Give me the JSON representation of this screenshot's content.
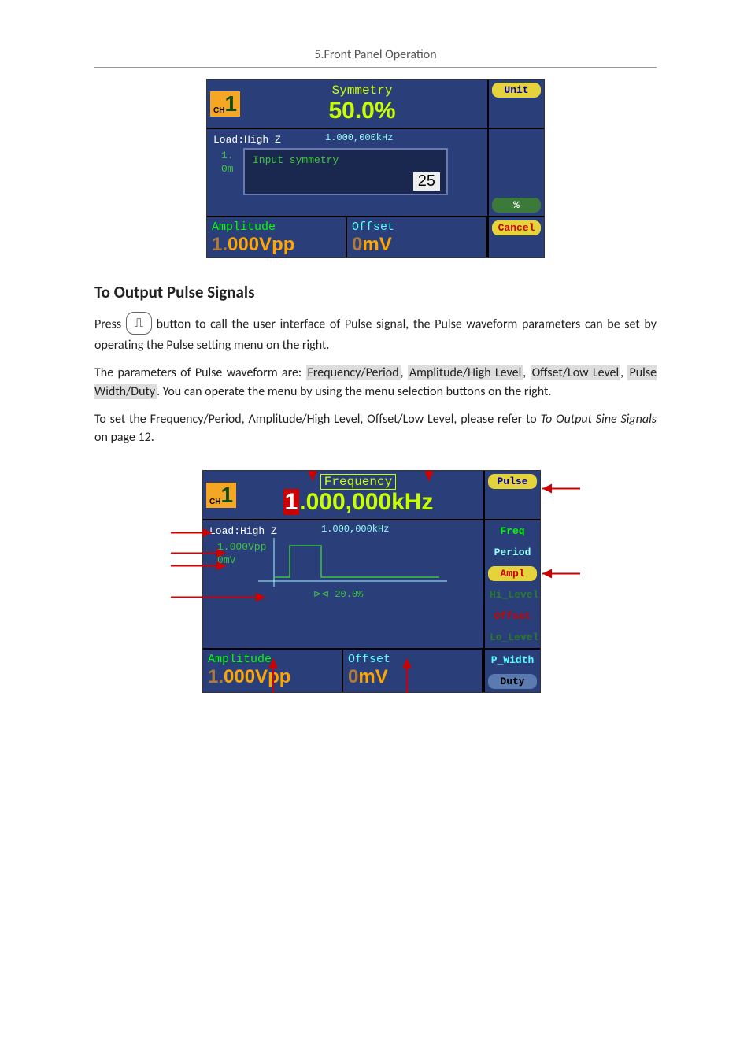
{
  "header": "5.Front Panel Operation",
  "inst1": {
    "ch_small": "CH",
    "ch_big": "1",
    "top_label": "Symmetry",
    "top_value": "50.0%",
    "load": "Load:High Z",
    "freq_span": "1.000,000kHz",
    "popup_label": "Input symmetry",
    "popup_value": "25",
    "wave_v1": "1.",
    "wave_v2": "0m",
    "side": {
      "unit": "Unit",
      "pct": "%",
      "cancel": "Cancel"
    },
    "ampl_label": "Amplitude",
    "ampl_value_green": "1.",
    "ampl_value_orange": "000Vpp",
    "offset_label": "Offset",
    "offset_value_orange": "0",
    "offset_value_unit": "mV"
  },
  "section_title": "To Output Pulse Signals",
  "p1a": "Press ",
  "p1b": " button to call the user interface of Pulse signal, the Pulse waveform parameters can be set by operating the Pulse setting menu on the right.",
  "p2a": "The parameters of Pulse waveform are: ",
  "p2_parts": {
    "fp": "Frequency/Period",
    "ah": "Amplitude/High Level",
    "ol": "Offset/Low Level",
    "pw": "Pulse Width/Duty"
  },
  "p2b": ". You can operate the menu by using the menu selection buttons on the right.",
  "p3a": "To set the Frequency/Period, Amplitude/High Level, Offset/Low Level, please refer to ",
  "p3b": "To Output Sine Signals",
  "p3c": " on page 12.",
  "pulse_icon_glyph": "⎍",
  "inst2": {
    "ch_small": "CH",
    "ch_big": "1",
    "top_label": "Frequency",
    "top_value_hl": "1",
    "top_value_mid": ".000,000",
    "top_value_unit": "kHz",
    "load": "Load:High Z",
    "freq_span": "1.000,000kHz",
    "vals": [
      "1.000Vpp",
      "0mV"
    ],
    "duty": "20.0%",
    "side": {
      "pulse": "Pulse",
      "freq": "Freq",
      "period": "Period",
      "ampl": "Ampl",
      "hi": "Hi_Level",
      "offset": "Offset",
      "lo": "Lo_Level",
      "pw": "P_Width",
      "duty": "Duty"
    },
    "ampl_label": "Amplitude",
    "ampl_value_green": "1.",
    "ampl_value_orange": "000Vpp",
    "offset_label": "Offset",
    "offset_value_orange": "0",
    "offset_value_unit": "mV"
  },
  "chart_data": {
    "type": "pulse_waveform",
    "frequency_khz": 1.0,
    "amplitude_vpp": 1.0,
    "offset_mv": 0,
    "duty_pct": 20.0,
    "load": "High Z"
  }
}
